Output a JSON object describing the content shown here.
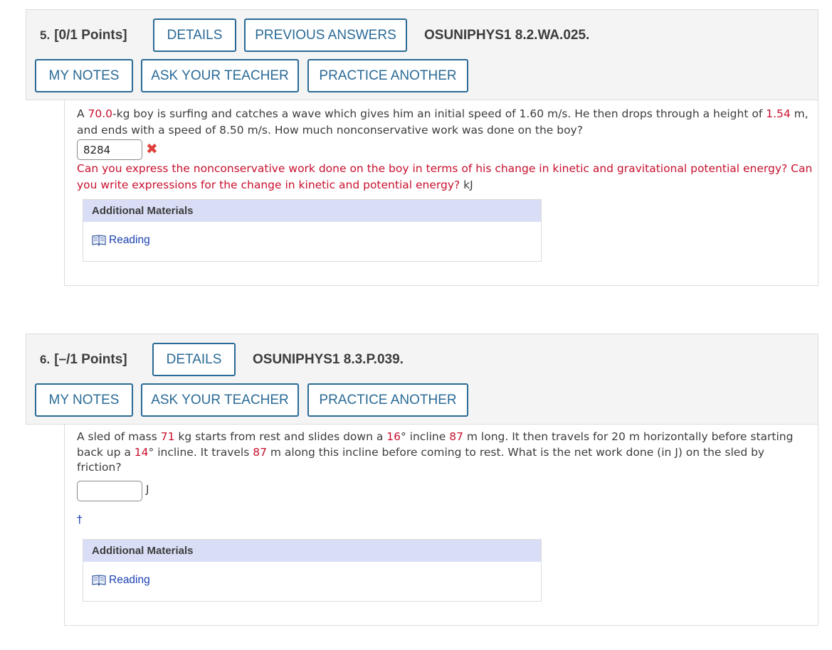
{
  "q5": {
    "number": "5.",
    "points": "[0/1 Points]",
    "details_label": "DETAILS",
    "previous_answers_label": "PREVIOUS ANSWERS",
    "assignment_code": "OSUNIPHYS1 8.2.WA.025.",
    "my_notes_label": "MY NOTES",
    "ask_teacher_label": "ASK YOUR TEACHER",
    "practice_another_label": "PRACTICE ANOTHER",
    "stem": {
      "t1": "A ",
      "mass": "70.0",
      "t2": "-kg boy is surfing and catches a wave which gives him an initial speed of 1.60 m/s. He then drops through a height of ",
      "height": "1.54",
      "t3": " m, and ends with a speed of 8.50 m/s. How much nonconservative work was done on the boy?"
    },
    "answer_value": "8284",
    "answer_status_icon": "incorrect-x-icon",
    "feedback": "Can you express the nonconservative work done on the boy in terms of his change in kinetic and gravitational potential energy? Can you write expressions for the change in kinetic and potential energy?",
    "unit": "kJ",
    "additional_materials_title": "Additional Materials",
    "reading_label": "Reading"
  },
  "q6": {
    "number": "6.",
    "points": "[–/1 Points]",
    "details_label": "DETAILS",
    "assignment_code": "OSUNIPHYS1 8.3.P.039.",
    "my_notes_label": "MY NOTES",
    "ask_teacher_label": "ASK YOUR TEACHER",
    "practice_another_label": "PRACTICE ANOTHER",
    "stem": {
      "t1": "A sled of mass ",
      "mass": "71",
      "t2": " kg starts from rest and slides down a ",
      "angle1": "16",
      "t3": "° incline ",
      "len1": "87",
      "t4": " m long. It then travels for 20 m horizontally before starting back up a ",
      "angle2": "14",
      "t5": "° incline. It travels ",
      "len2": "87",
      "t6": " m along this incline before coming to rest. What is the net work done (in J) on the sled by friction?"
    },
    "answer_value": "",
    "unit": "J",
    "footnote_marker": "†",
    "additional_materials_title": "Additional Materials",
    "reading_label": "Reading"
  },
  "colors": {
    "button_border": "#2a6a96",
    "highlight_red": "#c8102e",
    "header_bg": "#f4f4f4",
    "additional_materials_bg": "#d9def6",
    "link_blue": "#1a3fb0"
  }
}
